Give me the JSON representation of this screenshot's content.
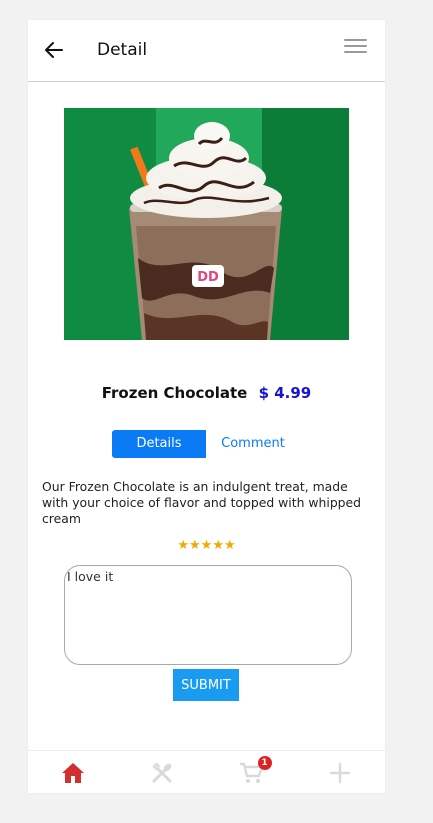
{
  "header": {
    "title": "Detail"
  },
  "product": {
    "name": "Frozen Chocolate",
    "price": "$ 4.99",
    "image_logo_text": "DD",
    "description": " Our Frozen Chocolate is an indulgent treat, made with your choice of flavor and topped with whipped cream",
    "rating": "★★★★★"
  },
  "tabs": [
    {
      "label": "Details",
      "active": true
    },
    {
      "label": "Comment",
      "active": false
    }
  ],
  "comment": {
    "value": "I love it"
  },
  "submit_label": "SUBMIT",
  "bottom_nav": [
    {
      "icon": "home-icon",
      "color": "#d32f2f"
    },
    {
      "icon": "utensils-icon",
      "color": "#d9d9d9"
    },
    {
      "icon": "cart-icon",
      "color": "#d9d9d9",
      "badge": "1"
    },
    {
      "icon": "plus-icon",
      "color": "#d9d9d9"
    }
  ],
  "colors": {
    "accent": "#0b7bf5",
    "price": "#1414d6",
    "star": "#f2a900",
    "badge": "#dd2222",
    "image_bg": "#13934a"
  }
}
